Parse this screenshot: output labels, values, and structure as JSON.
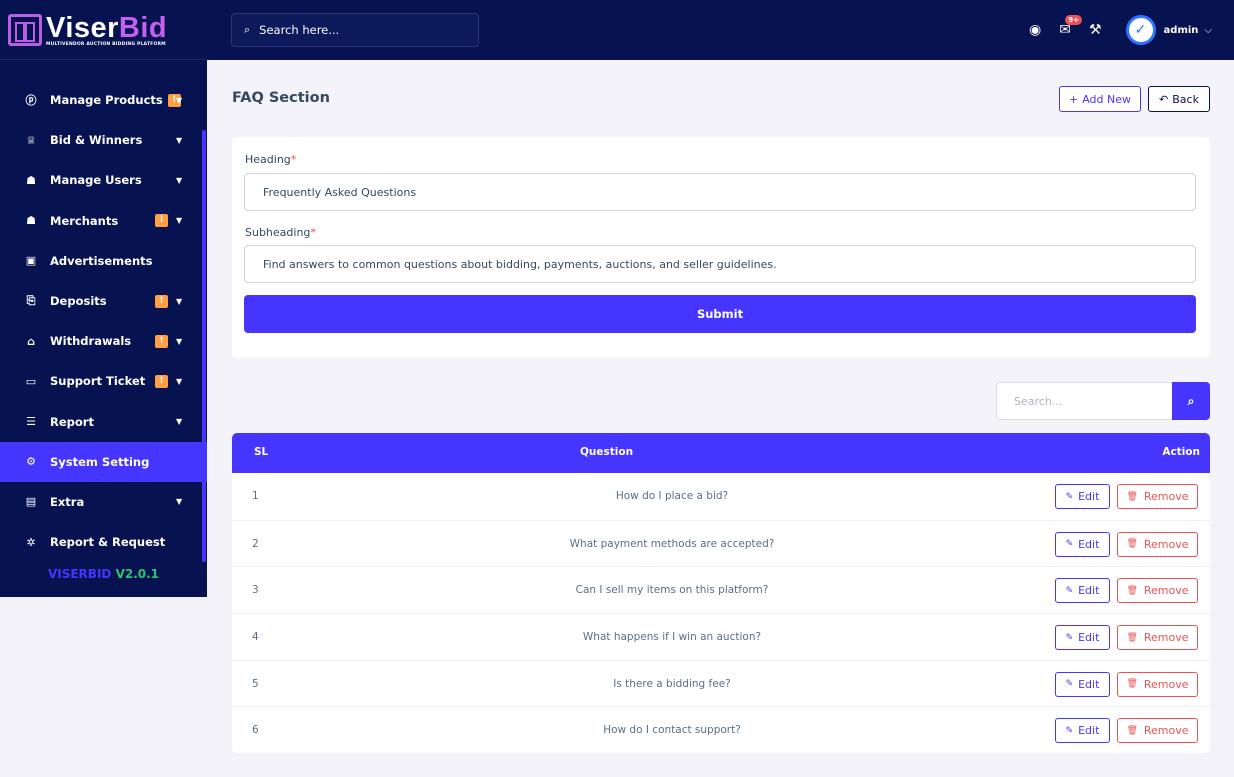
{
  "brand": {
    "name_main": "Viser",
    "name_accent": "Bid",
    "tagline": "MULTIVENDOR AUCTION BIDDING PLATFORM"
  },
  "topbar": {
    "search_placeholder": "Search here...",
    "notification_count": "9+",
    "user_name": "admin"
  },
  "sidebar": {
    "items": [
      {
        "label": "Manage Products",
        "icon": "product-icon",
        "glyph": "ⓟ",
        "badge": "!",
        "chevron": true
      },
      {
        "label": "Bid & Winners",
        "icon": "trophy-icon",
        "glyph": "♕",
        "badge": "",
        "chevron": true
      },
      {
        "label": "Manage Users",
        "icon": "users-icon",
        "glyph": "☗",
        "badge": "",
        "chevron": true
      },
      {
        "label": "Merchants",
        "icon": "merchants-icon",
        "glyph": "☗",
        "badge": "!",
        "chevron": true
      },
      {
        "label": "Advertisements",
        "icon": "ad-icon",
        "glyph": "▣",
        "badge": "",
        "chevron": false
      },
      {
        "label": "Deposits",
        "icon": "deposit-icon",
        "glyph": "⎘",
        "badge": "!",
        "chevron": true
      },
      {
        "label": "Withdrawals",
        "icon": "bank-icon",
        "glyph": "⌂",
        "badge": "!",
        "chevron": true
      },
      {
        "label": "Support Ticket",
        "icon": "ticket-icon",
        "glyph": "▭",
        "badge": "!",
        "chevron": true
      },
      {
        "label": "Report",
        "icon": "report-icon",
        "glyph": "☰",
        "badge": "",
        "chevron": true
      },
      {
        "label": "System Setting",
        "icon": "settings-icon",
        "glyph": "⚙",
        "badge": "",
        "chevron": false,
        "active": true
      },
      {
        "label": "Extra",
        "icon": "extra-icon",
        "glyph": "▤",
        "badge": "",
        "chevron": true
      },
      {
        "label": "Report & Request",
        "icon": "bug-icon",
        "glyph": "✲",
        "badge": "",
        "chevron": false
      }
    ],
    "version_name": "VISERBID",
    "version_number": "V2.0.1"
  },
  "page": {
    "title": "FAQ Section",
    "add_new_label": "Add New",
    "back_label": "Back"
  },
  "form": {
    "heading_label": "Heading",
    "heading_value": "Frequently Asked Questions",
    "subheading_label": "Subheading",
    "subheading_value": "Find answers to common questions about bidding, payments, auctions, and seller guidelines.",
    "submit_label": "Submit"
  },
  "table": {
    "search_placeholder": "Search...",
    "headers": {
      "sl": "SL",
      "question": "Question",
      "action": "Action"
    },
    "edit_label": "Edit",
    "remove_label": "Remove",
    "rows": [
      {
        "sl": "1",
        "question": "How do I place a bid?"
      },
      {
        "sl": "2",
        "question": "What payment methods are accepted?"
      },
      {
        "sl": "3",
        "question": "Can I sell my items on this platform?"
      },
      {
        "sl": "4",
        "question": "What happens if I win an auction?"
      },
      {
        "sl": "5",
        "question": "Is there a bidding fee?"
      },
      {
        "sl": "6",
        "question": "How do I contact support?"
      }
    ]
  },
  "colors": {
    "primary": "#4634ff",
    "navy": "#071251",
    "danger": "#ea5455",
    "warning": "#ff9f43",
    "success": "#28c76f"
  }
}
